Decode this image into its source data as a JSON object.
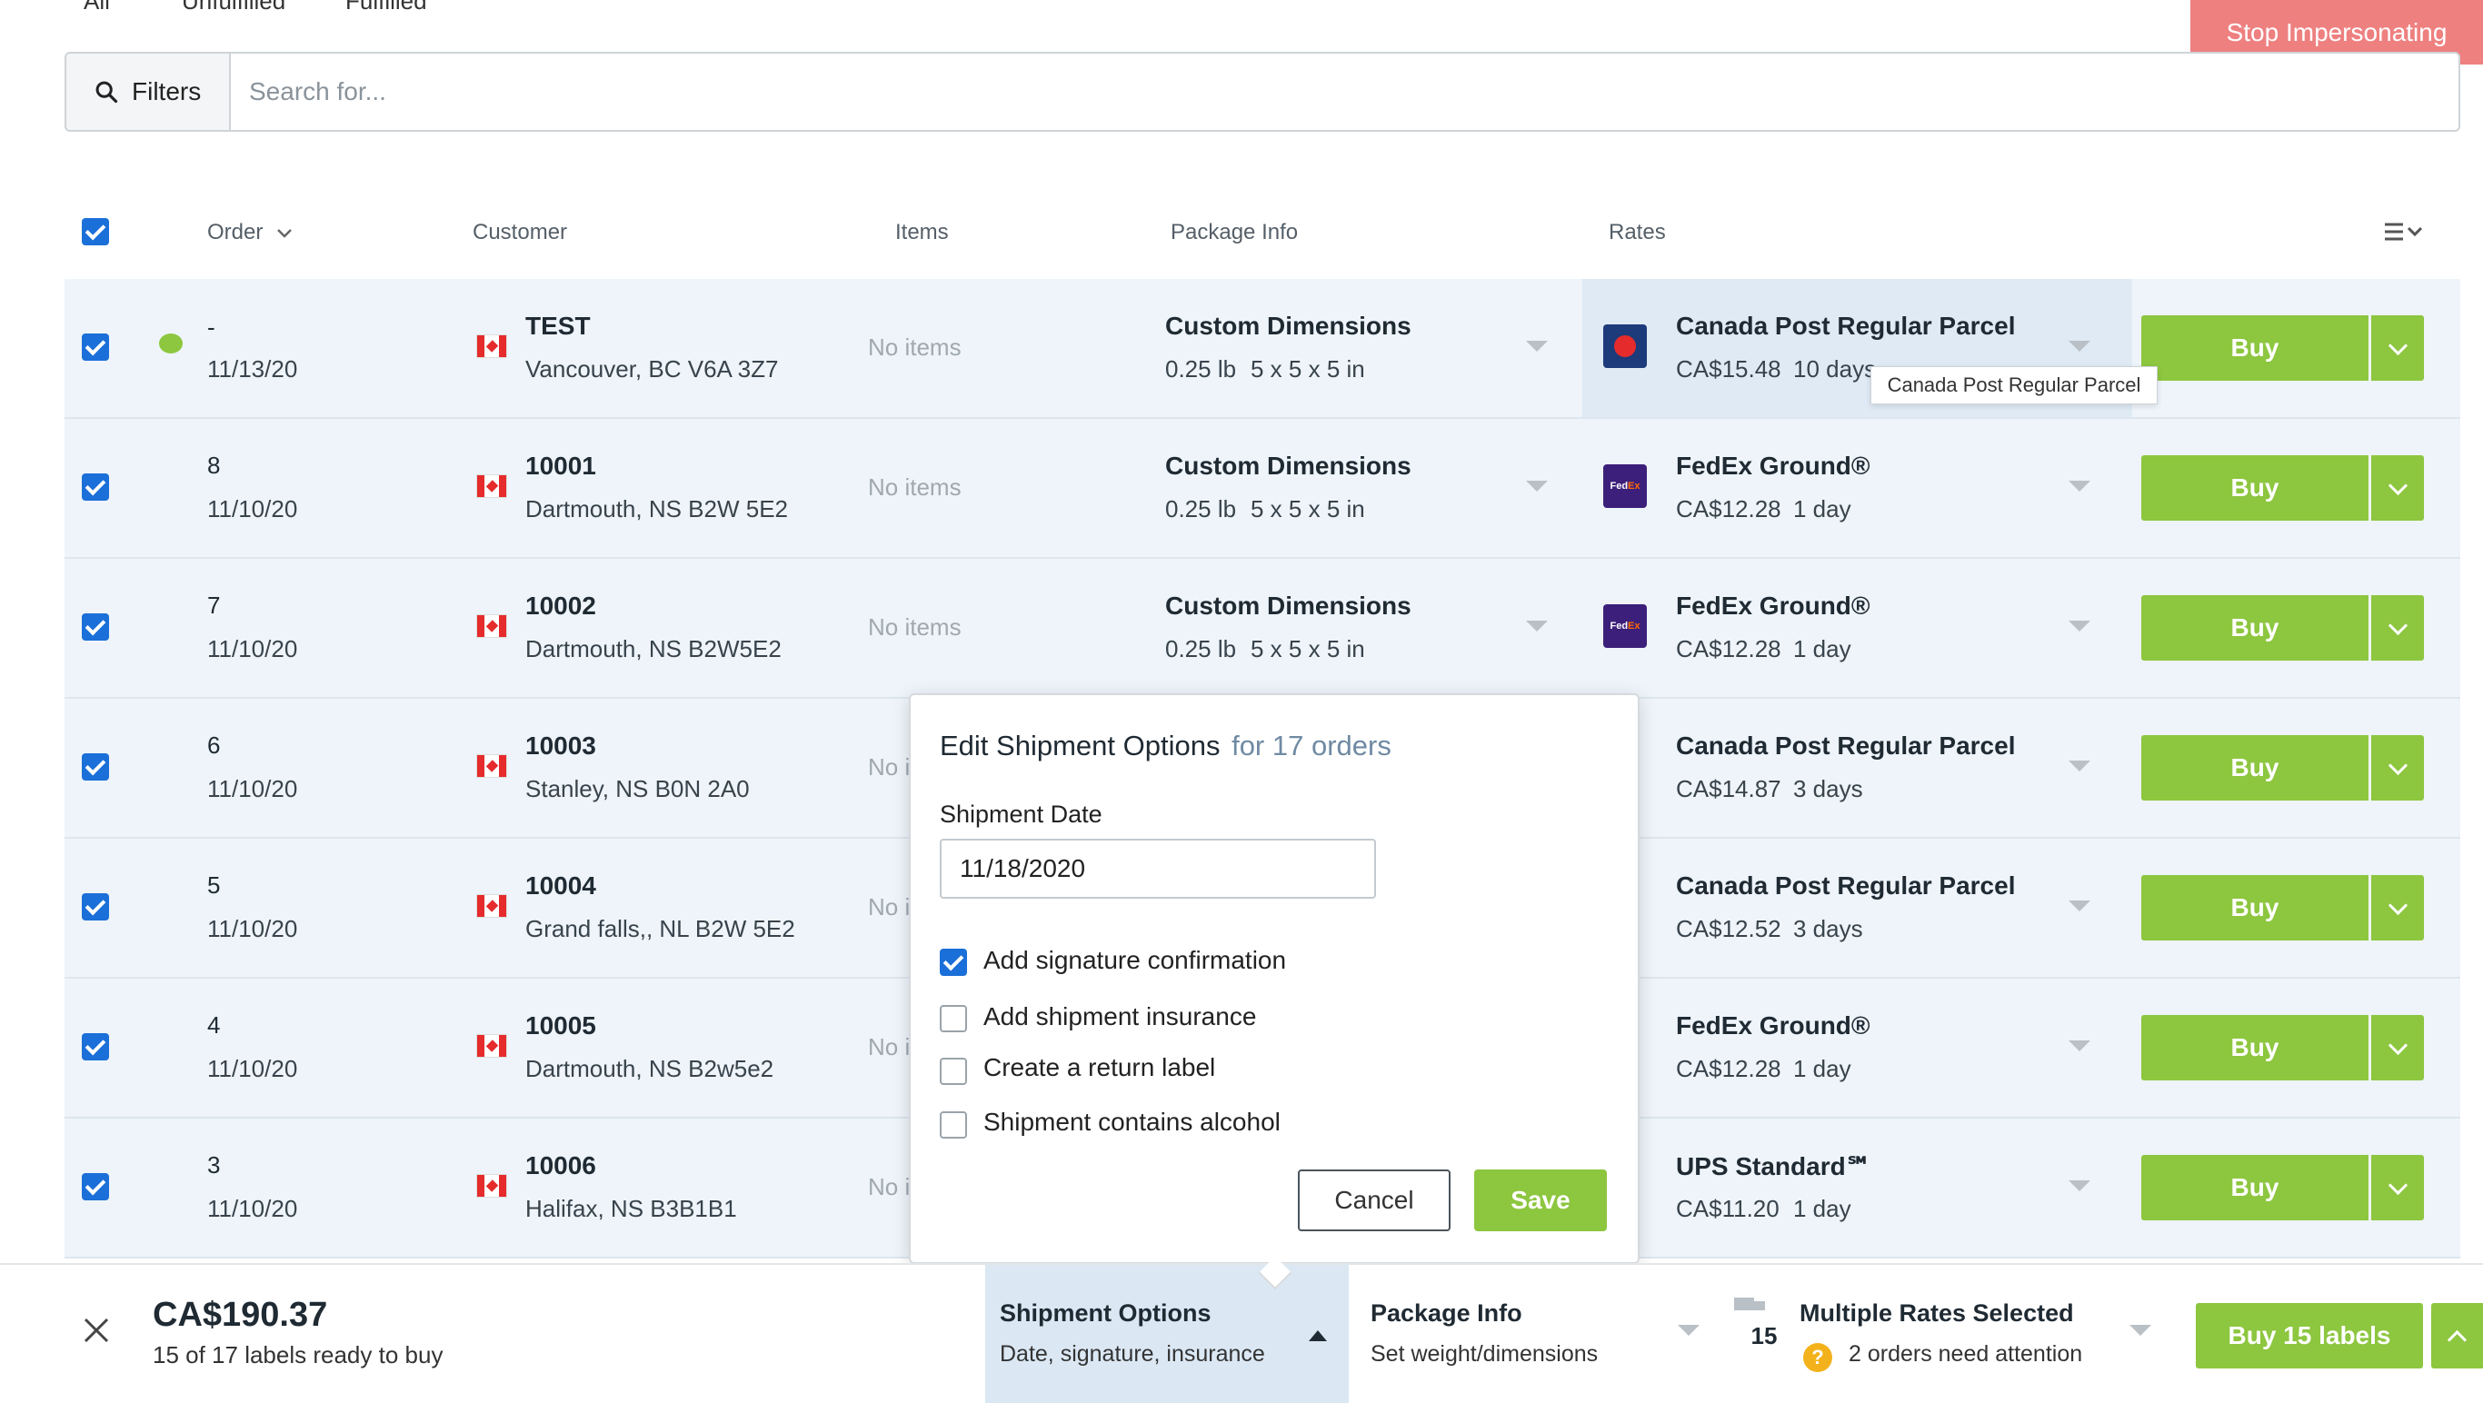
{
  "tabs": [
    "All",
    "Unfulfilled",
    "Fulfilled"
  ],
  "stop_impersonating": "Stop Impersonating",
  "search": {
    "filters_label": "Filters",
    "placeholder": "Search for..."
  },
  "columns": {
    "order": "Order",
    "customer": "Customer",
    "items": "Items",
    "package": "Package Info",
    "rates": "Rates"
  },
  "rows": [
    {
      "order": "-",
      "date": "11/13/20",
      "customer": "TEST",
      "address": "Vancouver, BC V6A 3Z7",
      "items": "No items",
      "pkg_title": "Custom Dimensions",
      "pkg_weight": "0.25 lb",
      "pkg_dims": "5 x 5 x 5 in",
      "carrier": "canada-post",
      "rate_name": "Canada Post Regular Parcel",
      "rate_price": "CA$15.48",
      "rate_days": "10 days",
      "buy": "Buy"
    },
    {
      "order": "8",
      "date": "11/10/20",
      "customer": "10001",
      "address": "Dartmouth, NS B2W 5E2",
      "items": "No items",
      "pkg_title": "Custom Dimensions",
      "pkg_weight": "0.25 lb",
      "pkg_dims": "5 x 5 x 5 in",
      "carrier": "fedex",
      "rate_name": "FedEx Ground®",
      "rate_price": "CA$12.28",
      "rate_days": "1 day",
      "buy": "Buy"
    },
    {
      "order": "7",
      "date": "11/10/20",
      "customer": "10002",
      "address": "Dartmouth, NS B2W5E2",
      "items": "No items",
      "pkg_title": "Custom Dimensions",
      "pkg_weight": "0.25 lb",
      "pkg_dims": "5 x 5 x 5 in",
      "carrier": "fedex",
      "rate_name": "FedEx Ground®",
      "rate_price": "CA$12.28",
      "rate_days": "1 day",
      "buy": "Buy"
    },
    {
      "order": "6",
      "date": "11/10/20",
      "customer": "10003",
      "address": "Stanley, NS B0N 2A0",
      "items": "No i",
      "rate_name": "Canada Post Regular Parcel",
      "rate_price": "CA$14.87",
      "rate_days": "3 days",
      "buy": "Buy"
    },
    {
      "order": "5",
      "date": "11/10/20",
      "customer": "10004",
      "address": "Grand falls,, NL B2W 5E2",
      "items": "No i",
      "rate_name": "Canada Post Regular Parcel",
      "rate_price": "CA$12.52",
      "rate_days": "3 days",
      "buy": "Buy"
    },
    {
      "order": "4",
      "date": "11/10/20",
      "customer": "10005",
      "address": "Dartmouth, NS B2w5e2",
      "items": "No i",
      "rate_name": "FedEx Ground®",
      "rate_price": "CA$12.28",
      "rate_days": "1 day",
      "buy": "Buy"
    },
    {
      "order": "3",
      "date": "11/10/20",
      "customer": "10006",
      "address": "Halifax, NS B3B1B1",
      "items": "No i",
      "rate_name": "UPS Standard℠",
      "rate_price": "CA$11.20",
      "rate_days": "1 day",
      "buy": "Buy"
    }
  ],
  "tooltip": "Canada Post Regular Parcel",
  "modal": {
    "title": "Edit Shipment Options",
    "subtitle": "for 17 orders",
    "date_label": "Shipment Date",
    "date_value": "11/18/2020",
    "options": [
      {
        "label": "Add signature confirmation",
        "checked": true
      },
      {
        "label": "Add shipment insurance",
        "checked": false
      },
      {
        "label": "Create a return label",
        "checked": false
      },
      {
        "label": "Shipment contains alcohol",
        "checked": false
      }
    ],
    "cancel": "Cancel",
    "save": "Save"
  },
  "footer": {
    "total": "CA$190.37",
    "ready": "15 of 17 labels ready to buy",
    "shipment_options_title": "Shipment Options",
    "shipment_options_sub": "Date, signature, insurance",
    "package_info_title": "Package Info",
    "package_info_sub": "Set weight/dimensions",
    "rates_count": "15",
    "rates_title": "Multiple Rates Selected",
    "rates_sub": "2 orders need attention",
    "buy_labels": "Buy 15 labels"
  },
  "colors": {
    "accent_green": "#8dc63f",
    "checkbox_blue": "#1b6fd8",
    "row_bg": "#eef4fa",
    "stop_red": "#ee8080"
  }
}
